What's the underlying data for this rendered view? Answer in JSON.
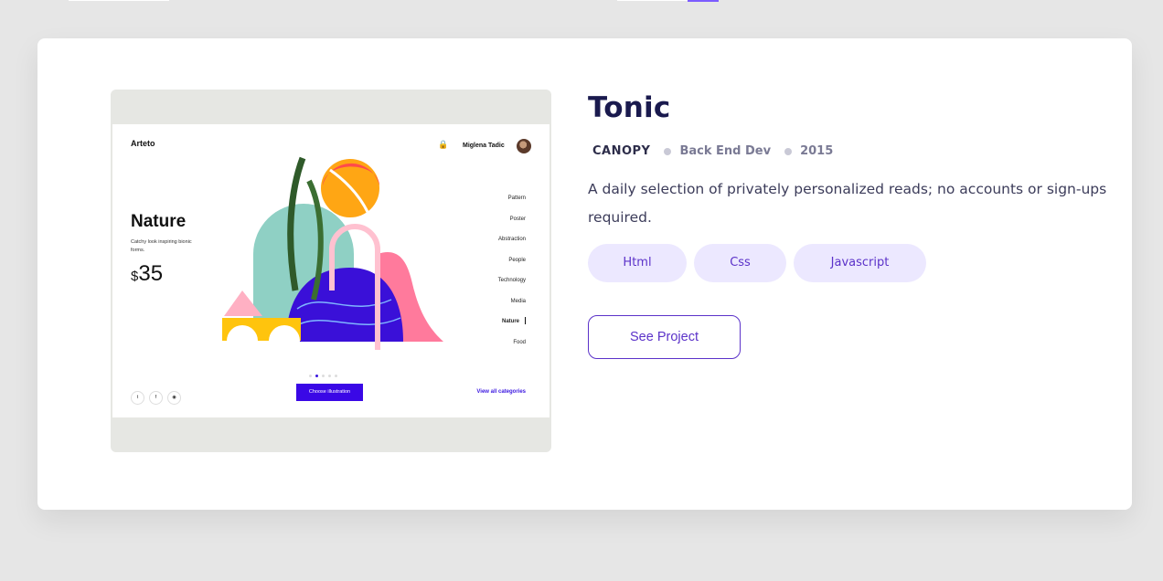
{
  "project": {
    "title": "Tonic",
    "client": "CANOPY",
    "role": "Back End Dev",
    "year": "2015",
    "description": "A daily selection of privately personalized reads; no accounts or sign-ups required.",
    "tags": [
      "Html",
      "Css",
      "Javascript"
    ],
    "cta_label": "See Project"
  },
  "preview": {
    "logo": "Arteto",
    "user_name": "Miglena Tadic",
    "hero_title": "Nature",
    "hero_subtitle": "Catchy look inspiring bionic forms.",
    "price_currency": "$",
    "price_value": "35",
    "categories": [
      "Pattern",
      "Poster",
      "Abstraction",
      "People",
      "Technology",
      "Media",
      "Nature",
      "Food"
    ],
    "active_category": "Nature",
    "button_label": "Choose illustration",
    "link_label": "View all categories",
    "social_icons": [
      "twitter-icon",
      "facebook-icon",
      "instagram-icon"
    ]
  },
  "colors": {
    "accent": "#5b32c9",
    "tag_bg": "#ece8ff",
    "title": "#1a1a4e",
    "preview_button": "#3a08e6"
  }
}
